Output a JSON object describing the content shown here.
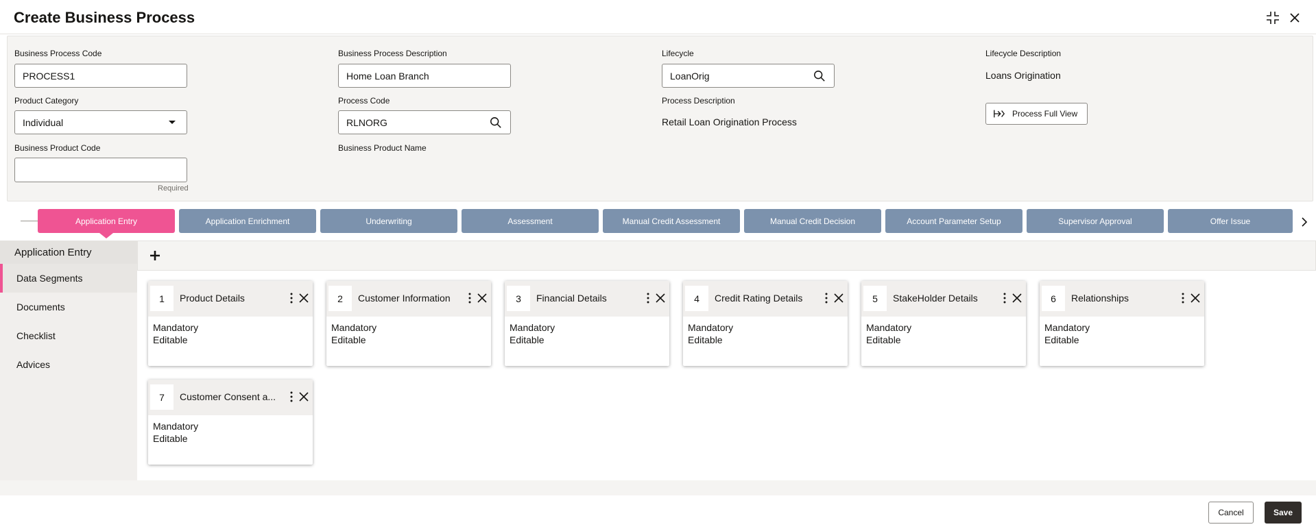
{
  "dialog": {
    "title": "Create Business Process"
  },
  "form": {
    "business_process_code": {
      "label": "Business Process Code",
      "value": "PROCESS1"
    },
    "business_process_description": {
      "label": "Business Process Description",
      "value": "Home Loan Branch"
    },
    "lifecycle": {
      "label": "Lifecycle",
      "value": "LoanOrig"
    },
    "lifecycle_description": {
      "label": "Lifecycle Description",
      "value": "Loans Origination"
    },
    "product_category": {
      "label": "Product Category",
      "value": "Individual"
    },
    "process_code": {
      "label": "Process Code",
      "value": "RLNORG"
    },
    "process_description": {
      "label": "Process Description",
      "value": "Retail Loan Origination Process"
    },
    "business_product_code": {
      "label": "Business Product Code",
      "value": "",
      "hint": "Required"
    },
    "business_product_name": {
      "label": "Business Product Name"
    },
    "process_full_view_label": "Process Full View"
  },
  "stages": [
    {
      "label": "Application Entry",
      "active": true
    },
    {
      "label": "Application Enrichment",
      "active": false
    },
    {
      "label": "Underwriting",
      "active": false
    },
    {
      "label": "Assessment",
      "active": false
    },
    {
      "label": "Manual Credit Assessment",
      "active": false
    },
    {
      "label": "Manual Credit Decision",
      "active": false
    },
    {
      "label": "Account Parameter Setup",
      "active": false
    },
    {
      "label": "Supervisor Approval",
      "active": false
    },
    {
      "label": "Offer Issue",
      "active": false
    }
  ],
  "left_nav": {
    "heading": "Application Entry",
    "items": [
      {
        "label": "Data Segments",
        "active": true
      },
      {
        "label": "Documents",
        "active": false
      },
      {
        "label": "Checklist",
        "active": false
      },
      {
        "label": "Advices",
        "active": false
      }
    ]
  },
  "segments": [
    {
      "number": "1",
      "name": "Product Details",
      "line1": "Mandatory",
      "line2": "Editable"
    },
    {
      "number": "2",
      "name": "Customer Information",
      "line1": "Mandatory",
      "line2": "Editable"
    },
    {
      "number": "3",
      "name": "Financial Details",
      "line1": "Mandatory",
      "line2": "Editable"
    },
    {
      "number": "4",
      "name": "Credit Rating Details",
      "line1": "Mandatory",
      "line2": "Editable"
    },
    {
      "number": "5",
      "name": "StakeHolder Details",
      "line1": "Mandatory",
      "line2": "Editable"
    },
    {
      "number": "6",
      "name": "Relationships",
      "line1": "Mandatory",
      "line2": "Editable"
    },
    {
      "number": "7",
      "name": "Customer Consent a...",
      "line1": "Mandatory",
      "line2": "Editable"
    }
  ],
  "footer": {
    "cancel_label": "Cancel",
    "save_label": "Save"
  },
  "colors": {
    "active_stage": "#ef5493",
    "stage": "#7c92ad",
    "save_button": "#312d2a"
  }
}
